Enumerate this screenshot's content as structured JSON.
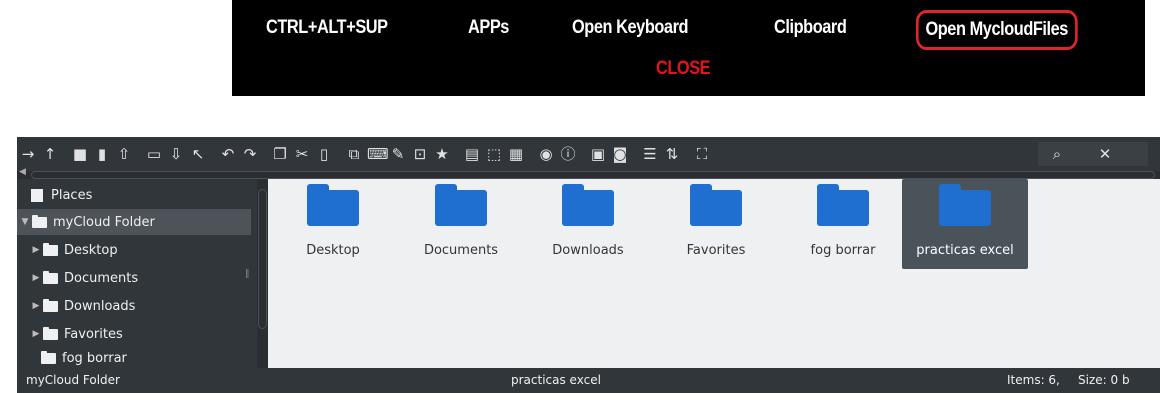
{
  "topbar": {
    "items": [
      "CTRL+ALT+SUP",
      "APPs",
      "Open Keyboard",
      "Clipboard",
      "Open MycloudFiles"
    ],
    "close_label": "CLOSE",
    "accent_color": "#e8131a"
  },
  "toolbar": {
    "icons": [
      "forward-icon",
      "up-icon",
      "new-folder-icon",
      "new-file-icon",
      "upload-icon",
      "folder-icon",
      "download-icon",
      "cursor-icon",
      "undo-icon",
      "redo-icon",
      "copy-icon",
      "cut-icon",
      "paste-icon",
      "duplicate-icon",
      "rename-icon",
      "edit-icon",
      "resize-icon",
      "favorite-icon",
      "select-all-icon",
      "select-none-icon",
      "invert-selection-icon",
      "preview-icon",
      "info-icon",
      "archive-icon",
      "extract-icon",
      "list-view-icon",
      "sort-icon",
      "fullscreen-icon",
      "search-icon",
      "close-icon"
    ]
  },
  "sidebar": {
    "places_label": "Places",
    "root_label": "myCloud Folder",
    "items": [
      {
        "label": "Desktop"
      },
      {
        "label": "Documents"
      },
      {
        "label": "Downloads"
      },
      {
        "label": "Favorites"
      },
      {
        "label": "fog borrar"
      }
    ]
  },
  "content": {
    "files": [
      {
        "name": "Desktop"
      },
      {
        "name": "Documents"
      },
      {
        "name": "Downloads"
      },
      {
        "name": "Favorites"
      },
      {
        "name": "fog borrar"
      },
      {
        "name": "practicas excel",
        "selected": true
      }
    ],
    "folder_color": "#1f6fd0"
  },
  "status": {
    "path": "myCloud Folder",
    "selected": "practicas excel",
    "items": "Items: 6,",
    "size": "Size: 0 b"
  }
}
